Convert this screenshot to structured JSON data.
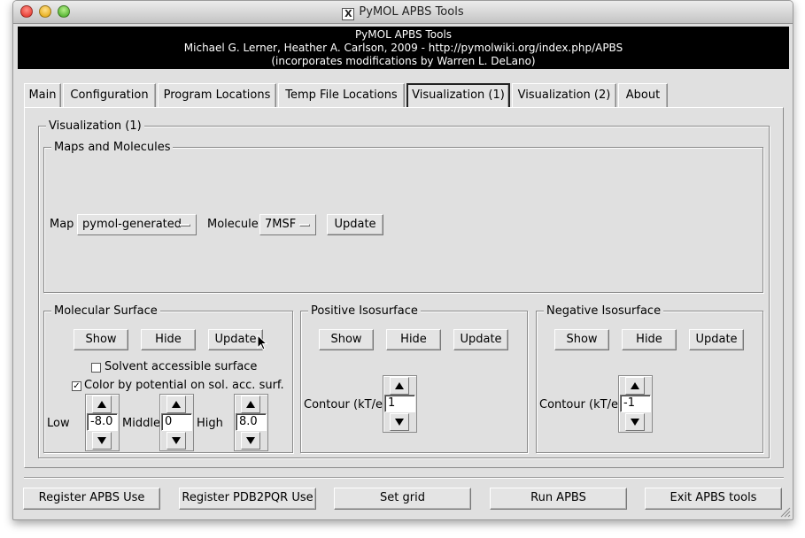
{
  "window": {
    "title": "PyMOL APBS Tools",
    "title_icon": "x11-icon",
    "title_icon_glyph": "X"
  },
  "banner": {
    "line1": "PyMOL APBS Tools",
    "line2": "Michael G. Lerner, Heather A. Carlson, 2009 - http://pymolwiki.org/index.php/APBS",
    "line3": "(incorporates modifications by Warren L. DeLano)"
  },
  "tabs": [
    {
      "label": "Main"
    },
    {
      "label": "Configuration"
    },
    {
      "label": "Program Locations"
    },
    {
      "label": "Temp File Locations"
    },
    {
      "label": "Visualization (1)",
      "active": true
    },
    {
      "label": "Visualization (2)"
    },
    {
      "label": "About"
    }
  ],
  "visualization": {
    "title": "Visualization (1)",
    "maps": {
      "title": "Maps and Molecules",
      "map_label": "Map",
      "map_value": "pymol-generated",
      "molecule_label": "Molecule",
      "molecule_value": "7MSF",
      "update_label": "Update"
    },
    "molecular_surface": {
      "title": "Molecular Surface",
      "show_label": "Show",
      "hide_label": "Hide",
      "update_label": "Update",
      "solvent_label": "Solvent accessible surface",
      "solvent_checked": false,
      "color_label": "Color by potential on sol. acc. surf.",
      "color_checked": true,
      "color_check_glyph": "✓",
      "low_label": "Low",
      "low_value": "-8.0",
      "middle_label": "Middle",
      "middle_value": "0",
      "high_label": "High",
      "high_value": "8.0"
    },
    "positive": {
      "title": "Positive Isosurface",
      "show_label": "Show",
      "hide_label": "Hide",
      "update_label": "Update",
      "contour_label": "Contour (kT/e)",
      "contour_value": "1"
    },
    "negative": {
      "title": "Negative Isosurface",
      "show_label": "Show",
      "hide_label": "Hide",
      "update_label": "Update",
      "contour_label": "Contour (kT/e)",
      "contour_value": "-1"
    }
  },
  "bottom_buttons": {
    "register_apbs": "Register APBS Use",
    "register_pdb2pqr": "Register PDB2PQR Use",
    "set_grid": "Set grid",
    "run_apbs": "Run APBS",
    "exit": "Exit APBS tools"
  }
}
